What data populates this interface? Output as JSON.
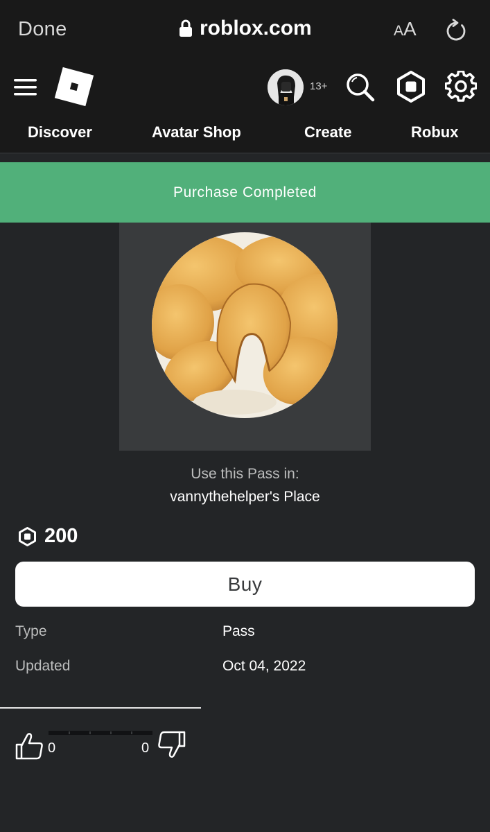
{
  "browser": {
    "done_label": "Done",
    "url": "roblox.com",
    "text_size_small": "A",
    "text_size_large": "A"
  },
  "header": {
    "age_badge": "13+",
    "nav": [
      "Discover",
      "Avatar Shop",
      "Create",
      "Robux"
    ]
  },
  "banner": {
    "message": "Purchase Completed",
    "color": "#51b07a"
  },
  "item": {
    "use_pass_label": "Use this Pass in:",
    "place_name": "vannythehelper's Place",
    "price": "200",
    "buy_label": "Buy",
    "details": [
      {
        "label": "Type",
        "value": "Pass"
      },
      {
        "label": "Updated",
        "value": "Oct 04, 2022"
      }
    ]
  },
  "votes": {
    "up": "0",
    "down": "0"
  },
  "icons": [
    "lock-icon",
    "reload-icon",
    "menu-icon",
    "roblox-logo-icon",
    "avatar",
    "search-icon",
    "robux-icon",
    "gear-icon",
    "thumbs-up-icon",
    "thumbs-down-icon"
  ]
}
